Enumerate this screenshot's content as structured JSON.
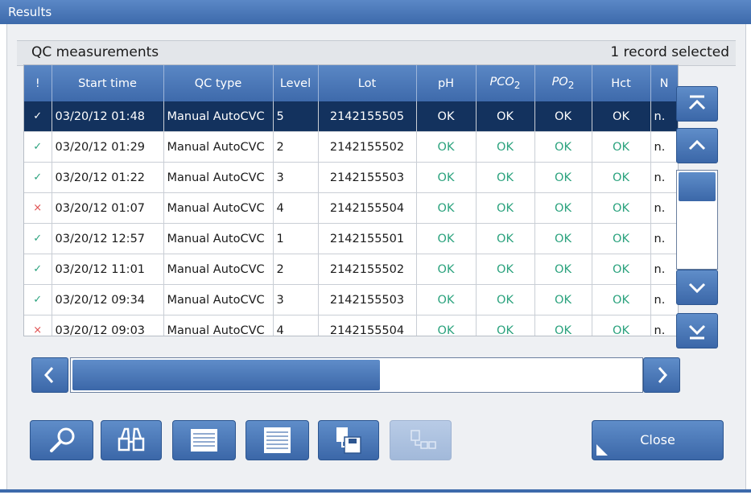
{
  "window": {
    "title": "Results"
  },
  "header": {
    "left": "QC measurements",
    "right": "1 record selected"
  },
  "table": {
    "columns": [
      "!",
      "Start time",
      "QC type",
      "Level",
      "Lot",
      "pH",
      "PCO2",
      "PO2",
      "Hct",
      "N"
    ],
    "pco2": {
      "main": "PCO",
      "sub": "2"
    },
    "po2": {
      "main": "PO",
      "sub": "2"
    },
    "rows": [
      {
        "mark": "✓",
        "start": "03/20/12 01:48",
        "type": "Manual AutoCVC",
        "level": "5",
        "lot": "2142155505",
        "ph": "OK",
        "pco2": "OK",
        "po2": "OK",
        "hct": "OK",
        "n": "n."
      },
      {
        "mark": "✓",
        "start": "03/20/12 01:29",
        "type": "Manual AutoCVC",
        "level": "2",
        "lot": "2142155502",
        "ph": "OK",
        "pco2": "OK",
        "po2": "OK",
        "hct": "OK",
        "n": "n."
      },
      {
        "mark": "✓",
        "start": "03/20/12 01:22",
        "type": "Manual AutoCVC",
        "level": "3",
        "lot": "2142155503",
        "ph": "OK",
        "pco2": "OK",
        "po2": "OK",
        "hct": "OK",
        "n": "n."
      },
      {
        "mark": "×",
        "start": "03/20/12 01:07",
        "type": "Manual AutoCVC",
        "level": "4",
        "lot": "2142155504",
        "ph": "OK",
        "pco2": "OK",
        "po2": "OK",
        "hct": "OK",
        "n": "n."
      },
      {
        "mark": "✓",
        "start": "03/20/12 12:57",
        "type": "Manual AutoCVC",
        "level": "1",
        "lot": "2142155501",
        "ph": "OK",
        "pco2": "OK",
        "po2": "OK",
        "hct": "OK",
        "n": "n."
      },
      {
        "mark": "✓",
        "start": "03/20/12 11:01",
        "type": "Manual AutoCVC",
        "level": "2",
        "lot": "2142155502",
        "ph": "OK",
        "pco2": "OK",
        "po2": "OK",
        "hct": "OK",
        "n": "n."
      },
      {
        "mark": "✓",
        "start": "03/20/12 09:34",
        "type": "Manual AutoCVC",
        "level": "3",
        "lot": "2142155503",
        "ph": "OK",
        "pco2": "OK",
        "po2": "OK",
        "hct": "OK",
        "n": "n."
      },
      {
        "mark": "×",
        "start": "03/20/12 09:03",
        "type": "Manual AutoCVC",
        "level": "4",
        "lot": "2142155504",
        "ph": "OK",
        "pco2": "OK",
        "po2": "OK",
        "hct": "OK",
        "n": "n."
      }
    ]
  },
  "icons": {
    "scroll_top": "double-chevron-up-icon",
    "scroll_up": "chevron-up-icon",
    "scroll_down": "chevron-down-icon",
    "scroll_bottom": "double-chevron-down-icon",
    "scroll_left": "chevron-left-icon",
    "scroll_right": "chevron-right-icon",
    "toolbar": [
      "magnifier-icon",
      "binoculars-icon",
      "list-icon",
      "list-alt-icon",
      "save-copy-icon",
      "transfer-icon"
    ]
  },
  "buttons": {
    "close": "Close"
  },
  "colors": {
    "accent": "#3d6aab",
    "selected_row": "#13325e",
    "ok": "#2aa27d",
    "error": "#e05050"
  }
}
